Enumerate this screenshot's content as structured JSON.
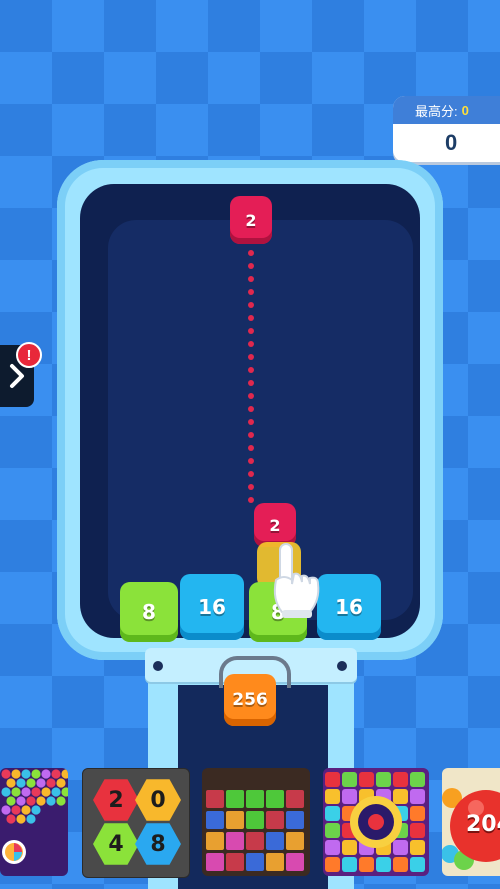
{
  "score": {
    "best_label": "最高分:",
    "best_value": "0",
    "current_value": "0"
  },
  "side_menu": {
    "badge_text": "!"
  },
  "shooter_tile": {
    "value": "2",
    "color": "#e41e56"
  },
  "falling_tile": {
    "value": "2",
    "color": "#e41e56"
  },
  "next_tile": {
    "value": "256",
    "color": "#ff8a1c"
  },
  "board_tiles": [
    {
      "value": "8",
      "color": "#8be23a"
    },
    {
      "value": "16",
      "color": "#23b6f0"
    },
    {
      "value": "8",
      "color": "#8be23a"
    },
    {
      "value": "16",
      "color": "#23b6f0"
    }
  ],
  "ads": {
    "hex_game": {
      "numbers": [
        "2",
        "0",
        "4",
        "8"
      ]
    },
    "ball_game": {
      "label": "204"
    }
  },
  "colors": {
    "background": "#2f7fe0",
    "board_frame": "#9fe4ff",
    "board_inner": "#0f2150",
    "aim_line": "#e0284e"
  }
}
